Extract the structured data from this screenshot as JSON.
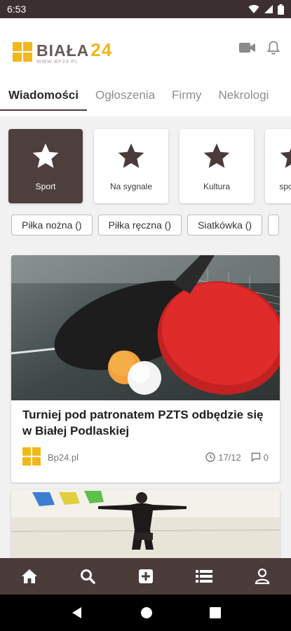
{
  "status": {
    "time": "6:53"
  },
  "header": {
    "logo": {
      "word1": "BIAŁA",
      "word2": "24",
      "sub": "WWW.BP24.PL"
    },
    "icons": [
      "video-camera-icon",
      "bell-icon"
    ]
  },
  "tabs": [
    {
      "label": "Wiadomości",
      "active": true
    },
    {
      "label": "Ogłoszenia"
    },
    {
      "label": "Firmy"
    },
    {
      "label": "Nekrologi"
    }
  ],
  "categories": [
    {
      "label": "Sport",
      "active": true
    },
    {
      "label": "Na sygnale"
    },
    {
      "label": "Kultura"
    },
    {
      "label": "spo"
    }
  ],
  "chips": [
    "Piłka nożna ()",
    "Piłka ręczna ()",
    "Siatkówka ()"
  ],
  "article": {
    "title": "Turniej pod patronatem PZTS odbędzie się w Białej Podlaskiej",
    "source": "Bp24.pl",
    "date": "17/12",
    "comments": "0"
  },
  "bottom_nav": [
    "home-icon",
    "search-icon",
    "add-icon",
    "list-icon",
    "profile-icon"
  ],
  "colors": {
    "brand": "#4b3c3c",
    "accent": "#f2b81b"
  }
}
